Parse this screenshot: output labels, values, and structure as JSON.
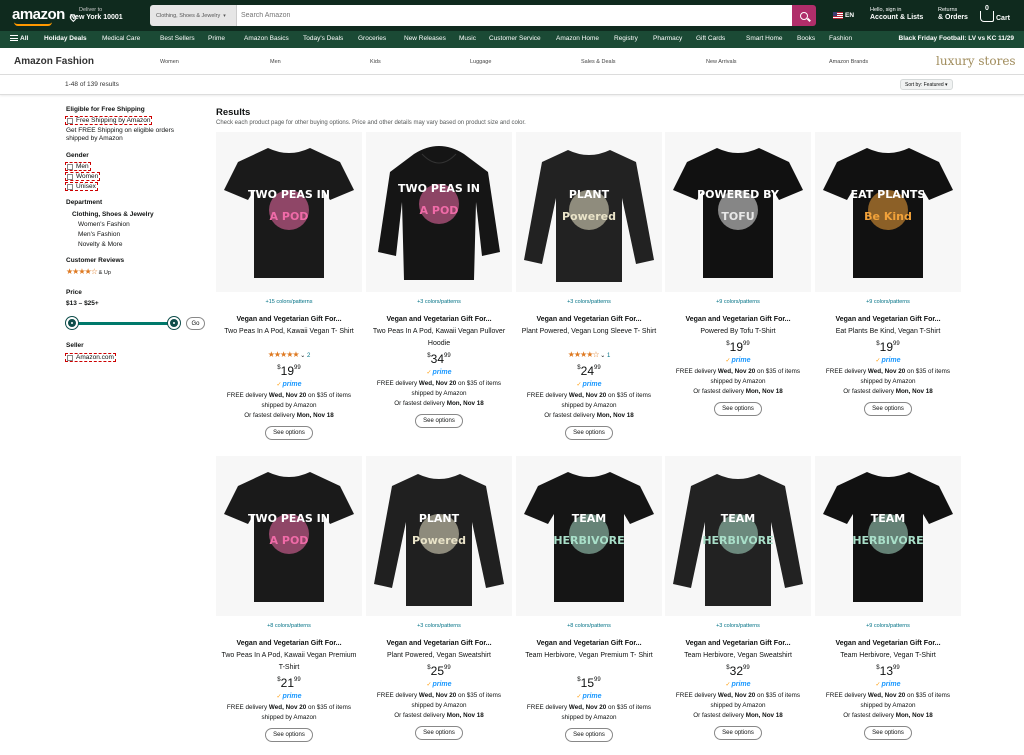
{
  "header": {
    "logo": "amazon",
    "deliver_to": "Deliver to",
    "location": "New York 10001",
    "search_category": "Clothing, Shoes & Jewelry",
    "search_placeholder": "Search Amazon",
    "language": "EN",
    "account_l1": "Hello, sign in",
    "account_l2": "Account & Lists",
    "orders_l1": "Returns",
    "orders_l2": "& Orders",
    "cart_count": "0",
    "cart_label": "Cart",
    "icons": [
      "location-pin-icon",
      "search-icon",
      "flag-us-icon",
      "cart-icon"
    ]
  },
  "nav": {
    "all": "All",
    "items": [
      "Holiday Deals",
      "Medical Care",
      "Best Sellers",
      "Prime",
      "Amazon Basics",
      "Today's Deals",
      "Groceries",
      "New Releases",
      "Music",
      "Customer Service",
      "Amazon Home",
      "Registry",
      "Pharmacy",
      "Gift Cards",
      "Smart Home",
      "Books",
      "Fashion"
    ],
    "promo": "Black Friday Football: LV vs KC 11/29"
  },
  "subnav": {
    "title": "Amazon Fashion",
    "links": [
      "Women",
      "Men",
      "Kids",
      "Luggage",
      "Sales & Deals",
      "New Arrivals",
      "Amazon Brands"
    ],
    "luxury": "luxury stores"
  },
  "resbar": {
    "count": "1-48 of 139 results",
    "sort": "Sort by:  Featured"
  },
  "sidebar": {
    "shipping_h": "Eligible for Free Shipping",
    "shipping_opt": "Free Shipping by Amazon",
    "shipping_note_1": "Get FREE Shipping on eligible orders",
    "shipping_note_2": "shipped by Amazon",
    "gender_h": "Gender",
    "gender_opts": [
      "Men",
      "Women",
      "Unisex"
    ],
    "dept_h": "Department",
    "dept_main": "Clothing, Shoes & Jewelry",
    "dept_items": [
      "Women's Fashion",
      "Men's Fashion",
      "Novelty & More"
    ],
    "reviews_h": "Customer Reviews",
    "reviews_stars": "★★★★☆",
    "reviews_up": "& Up",
    "price_h": "Price",
    "price_range": "$13 – $25+",
    "go": "Go",
    "seller_h": "Seller",
    "seller_opt": "Amazon.com"
  },
  "results": {
    "heading": "Results",
    "sub": "Check each product page for other buying options. Price and other details may vary based on product size and color."
  },
  "products": [
    {
      "colors": "+15 colors/patterns",
      "title": "Vegan and Vegetarian Gift For...",
      "sub1": "Two Peas In A Pod, Kawaii Vegan T-",
      "sub2": "Shirt",
      "stars": "★★★★★",
      "rating_count": "2",
      "dollars": "19",
      "cents": "99",
      "prime": "prime",
      "deliv1": "FREE delivery",
      "deliv_date": "Wed, Nov 20",
      "deliv2": "on $35 of items",
      "deliv3": "shipped by Amazon",
      "fast": "Or fastest delivery",
      "fast_date": "Mon, Nov 18",
      "btn": "See options",
      "art": "TWO PEAS IN A POD",
      "kind": "tee",
      "garment": "#1a1a1a",
      "accent": "#f06ba8"
    },
    {
      "colors": "+3 colors/patterns",
      "title": "Vegan and Vegetarian Gift For...",
      "sub1": "Two Peas In A Pod, Kawaii Vegan",
      "sub2": "Pullover Hoodie",
      "stars": "",
      "rating_count": "",
      "dollars": "34",
      "cents": "99",
      "prime": "prime",
      "deliv1": "FREE delivery",
      "deliv_date": "Wed, Nov 20",
      "deliv2": "on $35 of items",
      "deliv3": "shipped by Amazon",
      "fast": "Or fastest delivery",
      "fast_date": "Mon, Nov 18",
      "btn": "See options",
      "art": "TWO PEAS IN A POD",
      "kind": "hoodie",
      "garment": "#151515",
      "accent": "#f06ba8"
    },
    {
      "colors": "+3 colors/patterns",
      "title": "Vegan and Vegetarian Gift For...",
      "sub1": "Plant Powered, Vegan Long Sleeve T-",
      "sub2": "Shirt",
      "stars": "★★★★☆",
      "rating_count": "1",
      "dollars": "24",
      "cents": "99",
      "prime": "prime",
      "deliv1": "FREE delivery",
      "deliv_date": "Wed, Nov 20",
      "deliv2": "on $35 of items",
      "deliv3": "shipped by Amazon",
      "fast": "Or fastest delivery",
      "fast_date": "Mon, Nov 18",
      "btn": "See options",
      "art": "PLANT Powered",
      "kind": "long",
      "garment": "#222222",
      "accent": "#e9e3c8"
    },
    {
      "colors": "+9 colors/patterns",
      "title": "Vegan and Vegetarian Gift For...",
      "sub1": "Powered By Tofu T-Shirt",
      "sub2": "",
      "stars": "",
      "rating_count": "",
      "dollars": "19",
      "cents": "99",
      "prime": "prime",
      "deliv1": "FREE delivery",
      "deliv_date": "Wed, Nov 20",
      "deliv2": "on $35 of items",
      "deliv3": "shipped by Amazon",
      "fast": "Or fastest delivery",
      "fast_date": "Mon, Nov 18",
      "btn": "See options",
      "art": "POWERED BY TOFU",
      "kind": "tee",
      "garment": "#111111",
      "accent": "#e8e8e8"
    },
    {
      "colors": "+9 colors/patterns",
      "title": "Vegan and Vegetarian Gift For...",
      "sub1": "Eat Plants Be Kind, Vegan T-Shirt",
      "sub2": "",
      "stars": "",
      "rating_count": "",
      "dollars": "19",
      "cents": "99",
      "prime": "prime",
      "deliv1": "FREE delivery",
      "deliv_date": "Wed, Nov 20",
      "deliv2": "on $35 of items",
      "deliv3": "shipped by Amazon",
      "fast": "Or fastest delivery",
      "fast_date": "Mon, Nov 18",
      "btn": "See options",
      "art": "EAT PLANTS Be Kind",
      "kind": "tee",
      "garment": "#111111",
      "accent": "#f2a23a"
    },
    {
      "colors": "+8 colors/patterns",
      "title": "Vegan and Vegetarian Gift For...",
      "sub1": "Two Peas In A Pod, Kawaii Vegan",
      "sub2": "Premium T-Shirt",
      "stars": "",
      "rating_count": "",
      "dollars": "21",
      "cents": "99",
      "prime": "prime",
      "deliv1": "FREE delivery",
      "deliv_date": "Wed, Nov 20",
      "deliv2": "on $35 of items",
      "deliv3": "shipped by Amazon",
      "fast": "",
      "fast_date": "",
      "btn": "See options",
      "art": "TWO PEAS IN A POD",
      "kind": "tee",
      "garment": "#1a1a1a",
      "accent": "#f06ba8"
    },
    {
      "colors": "+3 colors/patterns",
      "title": "Vegan and Vegetarian Gift For...",
      "sub1": "Plant Powered, Vegan Sweatshirt",
      "sub2": "",
      "stars": "",
      "rating_count": "",
      "dollars": "25",
      "cents": "99",
      "prime": "prime",
      "deliv1": "FREE delivery",
      "deliv_date": "Wed, Nov 20",
      "deliv2": "on $35 of items",
      "deliv3": "shipped by Amazon",
      "fast": "Or fastest delivery",
      "fast_date": "Mon, Nov 18",
      "btn": "See options",
      "art": "PLANT Powered",
      "kind": "long",
      "garment": "#202020",
      "accent": "#e9e3c8"
    },
    {
      "colors": "+8 colors/patterns",
      "title": "Vegan and Vegetarian Gift For...",
      "sub1": "Team Herbivore, Vegan Premium T-",
      "sub2": "Shirt",
      "stars": "",
      "rating_count": "",
      "dollars": "15",
      "cents": "99",
      "prime": "prime",
      "deliv1": "FREE delivery",
      "deliv_date": "Wed, Nov 20",
      "deliv2": "on $35 of items",
      "deliv3": "shipped by Amazon",
      "fast": "",
      "fast_date": "",
      "btn": "See options",
      "art": "TEAM HERBIVORE",
      "kind": "tee",
      "garment": "#151515",
      "accent": "#a9dfc9"
    },
    {
      "colors": "+3 colors/patterns",
      "title": "Vegan and Vegetarian Gift For...",
      "sub1": "Team Herbivore, Vegan Sweatshirt",
      "sub2": "",
      "stars": "",
      "rating_count": "",
      "dollars": "32",
      "cents": "99",
      "prime": "prime",
      "deliv1": "FREE delivery",
      "deliv_date": "Wed, Nov 20",
      "deliv2": "on $35 of items",
      "deliv3": "shipped by Amazon",
      "fast": "Or fastest delivery",
      "fast_date": "Mon, Nov 18",
      "btn": "See options",
      "art": "TEAM HERBIVORE",
      "kind": "long",
      "garment": "#222222",
      "accent": "#a9dfc9"
    },
    {
      "colors": "+9 colors/patterns",
      "title": "Vegan and Vegetarian Gift For...",
      "sub1": "Team Herbivore, Vegan T-Shirt",
      "sub2": "",
      "stars": "",
      "rating_count": "",
      "dollars": "13",
      "cents": "99",
      "prime": "prime",
      "deliv1": "FREE delivery",
      "deliv_date": "Wed, Nov 20",
      "deliv2": "on $35 of items",
      "deliv3": "shipped by Amazon",
      "fast": "Or fastest delivery",
      "fast_date": "Mon, Nov 18",
      "btn": "See options",
      "art": "TEAM HERBIVORE",
      "kind": "tee",
      "garment": "#111111",
      "accent": "#a9dfc9"
    }
  ]
}
